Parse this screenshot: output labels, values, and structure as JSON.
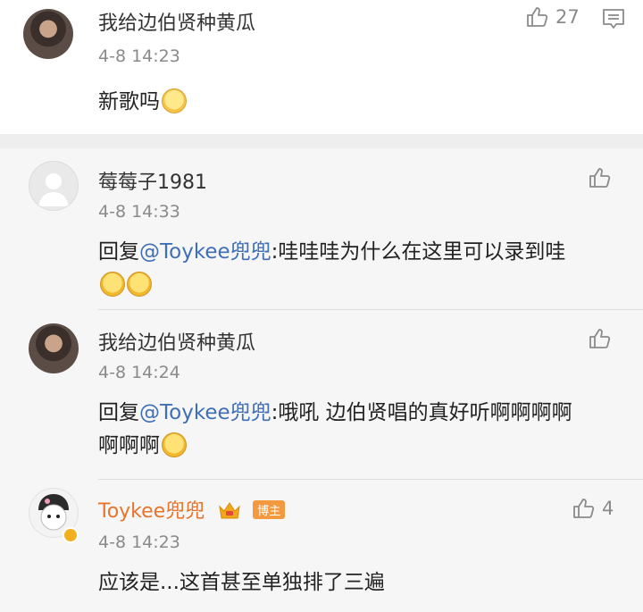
{
  "main_comment": {
    "author": "我给边伯贤种黄瓜",
    "time": "4-8 14:23",
    "text": "新歌吗",
    "likes": "27",
    "like_icon": "thumbs-up-icon",
    "comment_icon": "comment-box-icon"
  },
  "replies": [
    {
      "author": "莓莓子1981",
      "time": "4-8 14:33",
      "prefix": "回复",
      "mention": "@Toykee兜兜",
      "text": ":哇哇哇为什么在这里可以录到哇"
    },
    {
      "author": "我给边伯贤种黄瓜",
      "time": "4-8 14:24",
      "prefix": "回复",
      "mention": "@Toykee兜兜",
      "text_line1": ":哦吼 边伯贤唱的真好听啊啊啊啊",
      "text_line2": "啊啊啊"
    },
    {
      "author": "Toykee兜兜",
      "badge": "博主",
      "time": "4-8 14:23",
      "text": "应该是...这首甚至单独排了三遍",
      "likes": "4"
    }
  ],
  "colors": {
    "mention": "#3f6fb6",
    "owner_name": "#e8742c",
    "badge_bg": "#f39a3f",
    "band": "#eeeeee",
    "reply_bg": "#f6f6f6"
  }
}
